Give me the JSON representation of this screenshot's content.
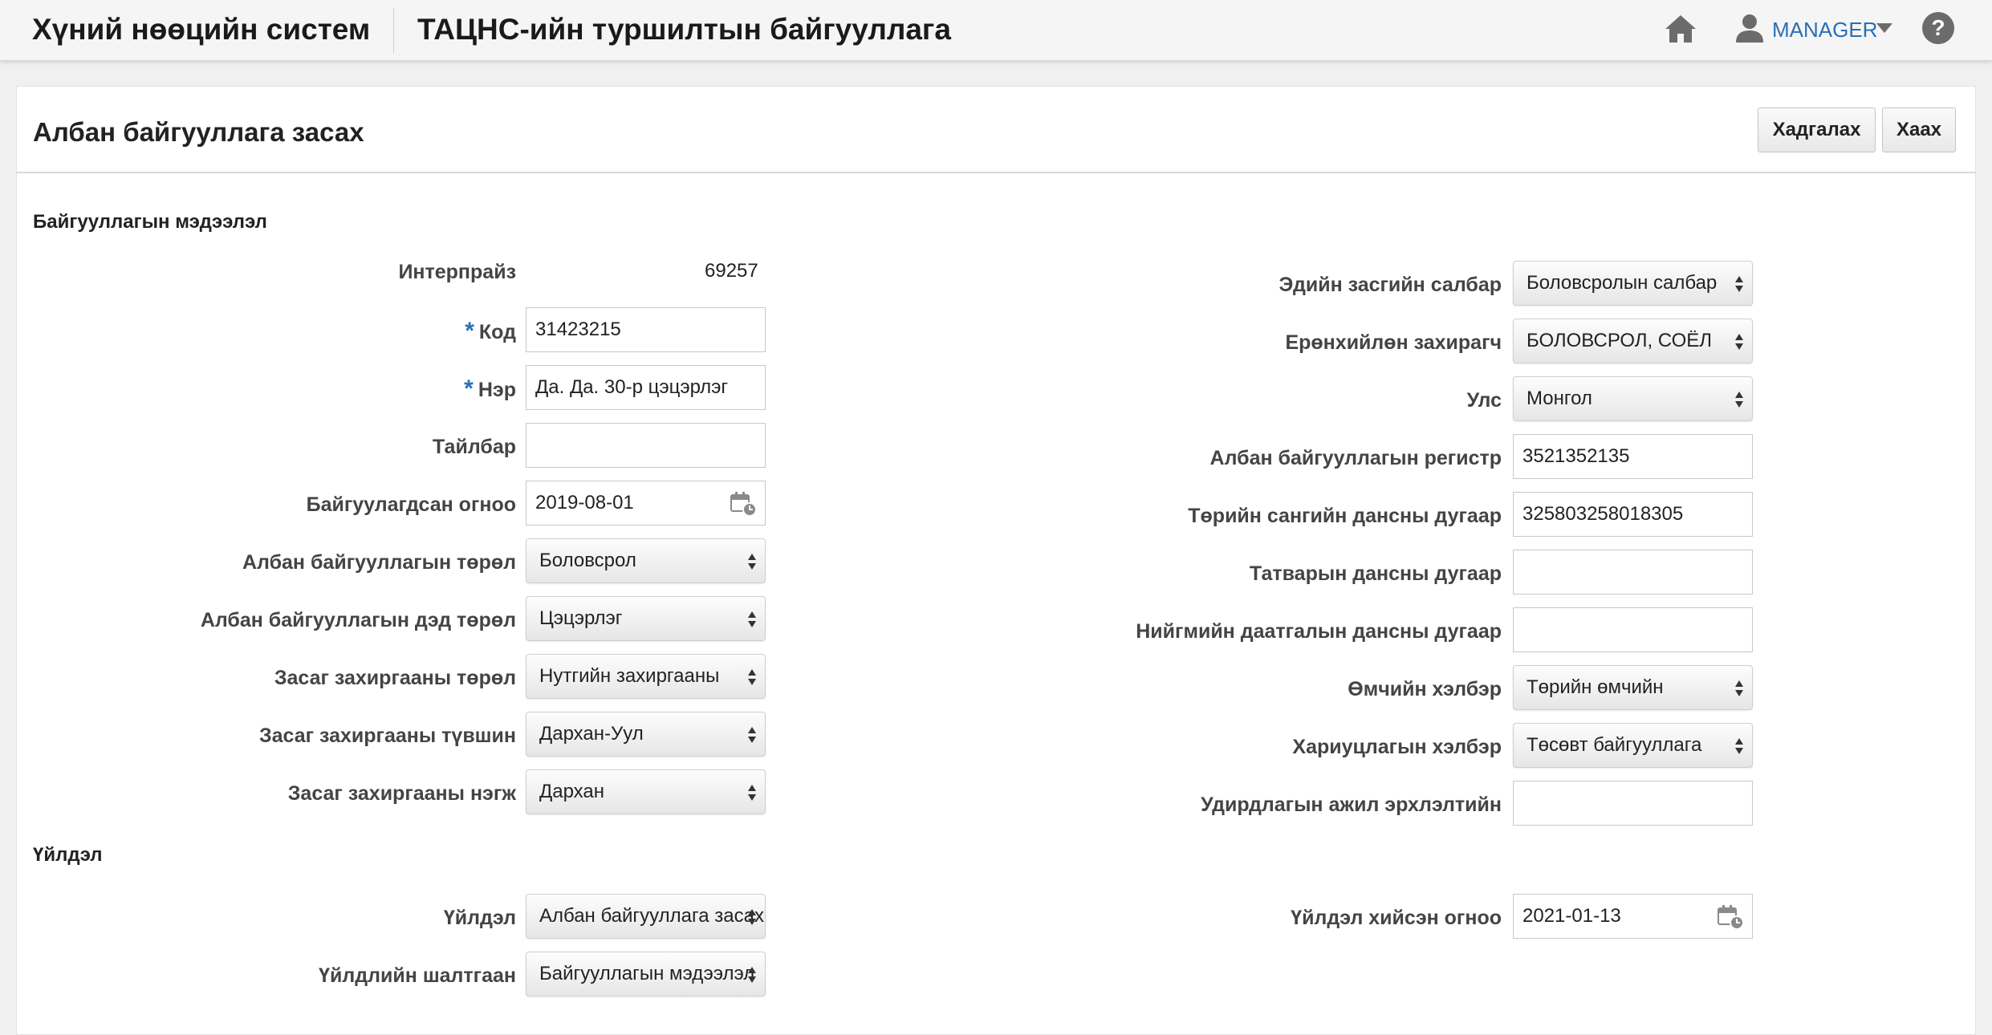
{
  "header": {
    "app_title": "Хүний нөөцийн систем",
    "org_title": "ТАЦНС-ийн туршилтын байгууллага",
    "user_label": "MANAGER",
    "icons": {
      "home": "home-icon",
      "user": "user-icon",
      "caret": "caret-down-icon",
      "help": "help-icon"
    }
  },
  "page": {
    "title": "Албан байгууллага засах",
    "save_label": "Хадгалах",
    "close_label": "Хаах"
  },
  "org_section": {
    "title": "Байгууллагын мэдээлэл",
    "left": {
      "enterprise": {
        "label": "Интерпрайз",
        "value": "69257"
      },
      "code": {
        "label": "Код",
        "value": "31423215",
        "required": "*"
      },
      "name": {
        "label": "Нэр",
        "value": "Да. Да. 30-р цэцэрлэг",
        "required": "*"
      },
      "description": {
        "label": "Тайлбар",
        "value": ""
      },
      "founded_date": {
        "label": "Байгуулагдсан огноо",
        "value": "2019-08-01"
      },
      "org_type": {
        "label": "Албан байгууллагын төрөл",
        "value": "Боловсрол"
      },
      "org_subtype": {
        "label": "Албан байгууллагын дэд төрөл",
        "value": "Цэцэрлэг"
      },
      "admin_type": {
        "label": "Засаг захиргааны төрөл",
        "value": "Нутгийн захиргааны"
      },
      "admin_level": {
        "label": "Засаг захиргааны түвшин",
        "value": "Дархан-Уул"
      },
      "admin_unit": {
        "label": "Засаг захиргааны нэгж",
        "value": "Дархан"
      }
    },
    "right": {
      "economic_sector": {
        "label": "Эдийн засгийн салбар",
        "value": "Боловсролын салбар"
      },
      "general_manager": {
        "label": "Ерөнхийлөн захирагч",
        "value": "БОЛОВСРОЛ, СОЁЛ"
      },
      "country": {
        "label": "Улс",
        "value": "Монгол"
      },
      "registry": {
        "label": "Албан байгууллагын регистр",
        "value": "3521352135"
      },
      "treasury_account": {
        "label": "Төрийн сангийн дансны дугаар",
        "value": "325803258018305"
      },
      "tax_account": {
        "label": "Татварын дансны дугаар",
        "value": ""
      },
      "social_insurance_account": {
        "label": "Нийгмийн даатгалын дансны дугаар",
        "value": ""
      },
      "ownership": {
        "label": "Өмчийн хэлбэр",
        "value": "Төрийн өмчийн"
      },
      "responsibility": {
        "label": "Хариуцлагын хэлбэр",
        "value": "Төсөвт байгууллага"
      },
      "management_authority": {
        "label": "Удирдлагын ажил эрхлэлтийн",
        "value": ""
      }
    }
  },
  "action_section": {
    "title": "Үйлдэл",
    "action": {
      "label": "Үйлдэл",
      "value": "Албан байгууллага засах"
    },
    "reason": {
      "label": "Үйлдлийн шалтгаан",
      "value": "Байгууллагын мэдээлэл"
    },
    "action_date": {
      "label": "Үйлдэл хийсэн огноо",
      "value": "2021-01-13"
    }
  }
}
